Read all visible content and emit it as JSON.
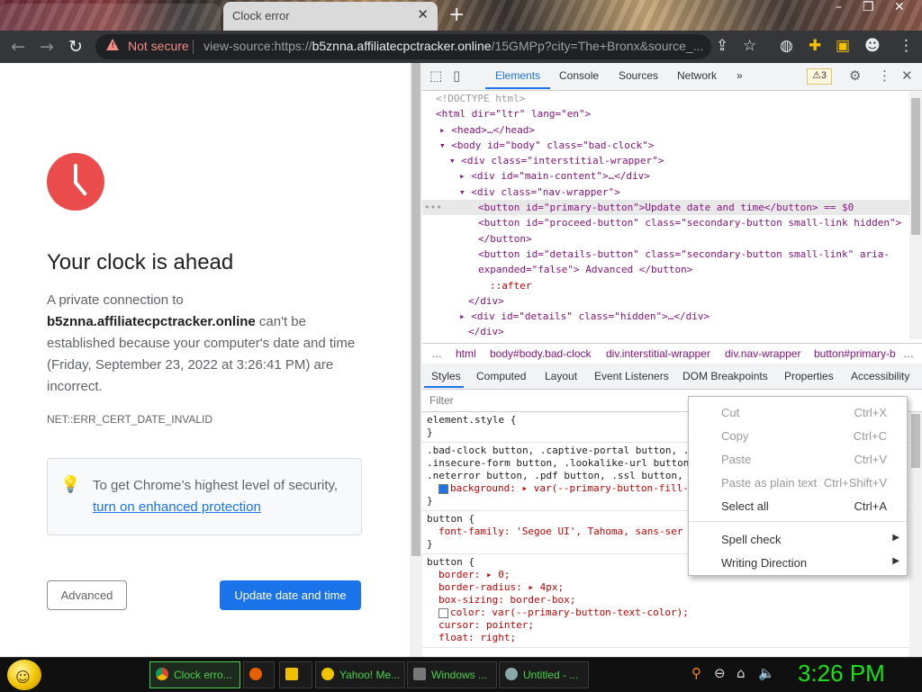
{
  "browser": {
    "tabs": [
      {
        "title": "Clock error"
      }
    ],
    "newtab": "+",
    "controls": {
      "minimize": "–",
      "maximize": "❐",
      "close": "✕"
    },
    "security": "Not secure",
    "url_prefix": "view-source:https://",
    "url_host": "b5znna.affiliatecpctracker.online",
    "url_rest": "/15GMPp?city=The+Bronx&source_..."
  },
  "page": {
    "title": "Your clock is ahead",
    "body_lead": "A private connection to",
    "body_host": "b5znna.affiliatecpctracker.online",
    "body_rest": " can't be established because your computer's date and time (Friday, September 23, 2022 at 3:26:41 PM) are incorrect.",
    "error_code": "NET::ERR_CERT_DATE_INVALID",
    "security_tip": "To get Chrome’s highest level of security,",
    "security_link": "turn on enhanced protection",
    "advanced_label": "Advanced",
    "update_label": "Update date and time"
  },
  "devtools": {
    "tabs": [
      "Elements",
      "Console",
      "Sources",
      "Network"
    ],
    "more": "»",
    "warnings": "⚠3",
    "dom_lines": [
      "<!DOCTYPE html>",
      "<html dir=\"ltr\" lang=\"en\">",
      "<head>…</head>",
      "<body id=\"body\" class=\"bad-clock\">",
      "<div class=\"interstitial-wrapper\">",
      "<div id=\"main-content\">…</div>",
      "<div class=\"nav-wrapper\">",
      "<button id=\"primary-button\">Update date and time</button> == $0",
      "<button id=\"proceed-button\" class=\"secondary-button small-link hidden\">",
      "</button>",
      "<button id=\"details-button\" class=\"secondary-button small-link\" aria-",
      "expanded=\"false\"> Advanced </button>",
      "::after",
      "</div>",
      "<div id=\"details\" class=\"hidden\">…</div>",
      "</div>"
    ],
    "breadcrumbs": [
      "…",
      "html",
      "body#body.bad-clock",
      "div.interstitial-wrapper",
      "div.nav-wrapper",
      "button#primary-b",
      "…"
    ],
    "subtabs": [
      "Styles",
      "Computed",
      "Layout",
      "Event Listeners",
      "DOM Breakpoints",
      "Properties",
      "Accessibility"
    ],
    "filter_placeholder": "Filter",
    "styles": [
      "element.style {",
      "}",
      ".bad-clock button, .captive-portal button, .",
      ".insecure-form button, .lookalike-url button",
      ".neterror button, .pdf button, .ssl button,",
      "background: ▸ var(--primary-button-fill-",
      "}",
      "button {",
      "font-family: 'Segoe UI', Tahoma, sans-ser",
      "}",
      "button {",
      "border: ▸ 0;",
      "border-radius: ▸ 4px;",
      "box-sizing: border-box;",
      "color: var(--primary-button-text-color);",
      "cursor: pointer;",
      "float: right;"
    ]
  },
  "context_menu": {
    "items": [
      {
        "label": "Cut",
        "shortcut": "Ctrl+X"
      },
      {
        "label": "Copy",
        "shortcut": "Ctrl+C"
      },
      {
        "label": "Paste",
        "shortcut": "Ctrl+V"
      },
      {
        "label": "Paste as plain text",
        "shortcut": "Ctrl+Shift+V"
      },
      {
        "label": "Select all",
        "shortcut": "Ctrl+A"
      },
      {
        "label": "Spell check",
        "shortcut": ""
      },
      {
        "label": "Writing Direction",
        "shortcut": ""
      }
    ]
  },
  "taskbar": {
    "items": [
      {
        "label": "Clock erro..."
      },
      {
        "label": ""
      },
      {
        "label": ""
      },
      {
        "label": "Yahoo! Me..."
      },
      {
        "label": "Windows ..."
      },
      {
        "label": "Untitled - ..."
      }
    ],
    "clock": "3:26 PM"
  }
}
